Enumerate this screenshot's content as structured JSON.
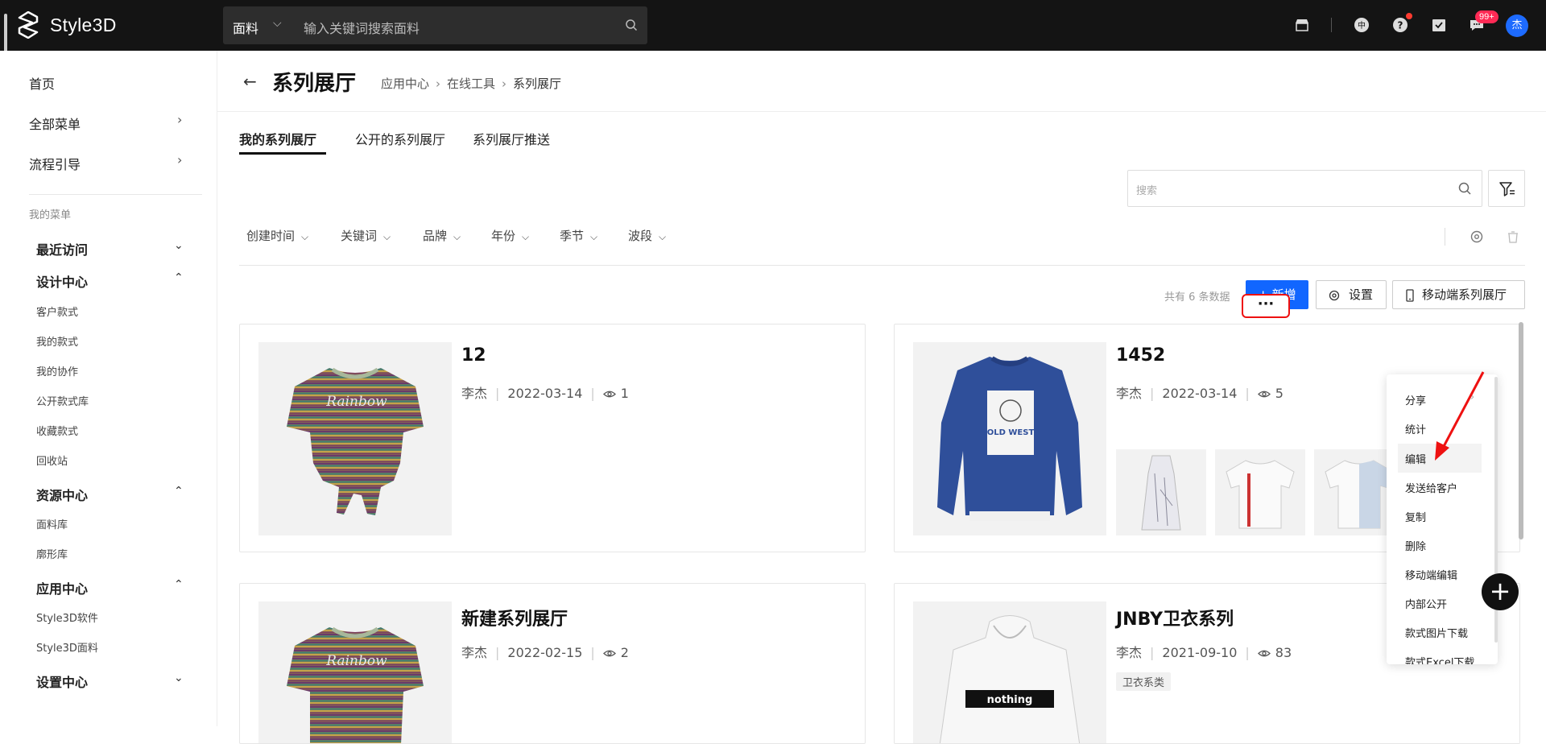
{
  "topbar": {
    "logo_text": "Style3D",
    "search_category": "面料",
    "search_placeholder": "输入关键词搜索面料",
    "badge_count": "99+",
    "avatar_initial": "杰"
  },
  "sidebar": {
    "home": "首页",
    "all_menu": "全部菜单",
    "process_guide": "流程引导",
    "my_menu": "我的菜单",
    "groups": [
      {
        "label": "最近访问",
        "items": []
      },
      {
        "label": "设计中心",
        "items": [
          "客户款式",
          "我的款式",
          "我的协作",
          "公开款式库",
          "收藏款式",
          "回收站"
        ]
      },
      {
        "label": "资源中心",
        "items": [
          "面料库",
          "廓形库"
        ]
      },
      {
        "label": "应用中心",
        "items": [
          "Style3D软件",
          "Style3D面料"
        ]
      },
      {
        "label": "设置中心",
        "items": []
      }
    ]
  },
  "header": {
    "title": "系列展厅",
    "breadcrumb": [
      "应用中心",
      "在线工具",
      "系列展厅"
    ]
  },
  "tabs": [
    "我的系列展厅",
    "公开的系列展厅",
    "系列展厅推送"
  ],
  "search": {
    "placeholder": "搜索"
  },
  "filters": [
    "创建时间",
    "关键词",
    "品牌",
    "年份",
    "季节",
    "波段"
  ],
  "toolbar": {
    "total": "共有 6 条数据",
    "add": "新增",
    "settings": "设置",
    "mobile": "移动端系列展厅"
  },
  "cards": [
    {
      "title": "12",
      "author": "李杰",
      "date": "2022-03-14",
      "views": "1",
      "tag": ""
    },
    {
      "title": "1452",
      "author": "李杰",
      "date": "2022-03-14",
      "views": "5",
      "tag": ""
    },
    {
      "title": "新建系列展厅",
      "author": "李杰",
      "date": "2022-02-15",
      "views": "2",
      "tag": ""
    },
    {
      "title": "JNBY卫衣系列",
      "author": "李杰",
      "date": "2021-09-10",
      "views": "83",
      "tag": "卫衣系类"
    }
  ],
  "context_menu": [
    "分享",
    "统计",
    "编辑",
    "发送给客户",
    "复制",
    "删除",
    "移动端编辑",
    "内部公开",
    "款式图片下载",
    "款式Excel下载"
  ],
  "shirt_print": {
    "rainbow": "Rainbow",
    "oldwest": "OLD WEST",
    "nothing": "nothing"
  },
  "colors": {
    "primary": "#1166ff",
    "topbar": "#141414",
    "annotation": "#ee1111"
  }
}
